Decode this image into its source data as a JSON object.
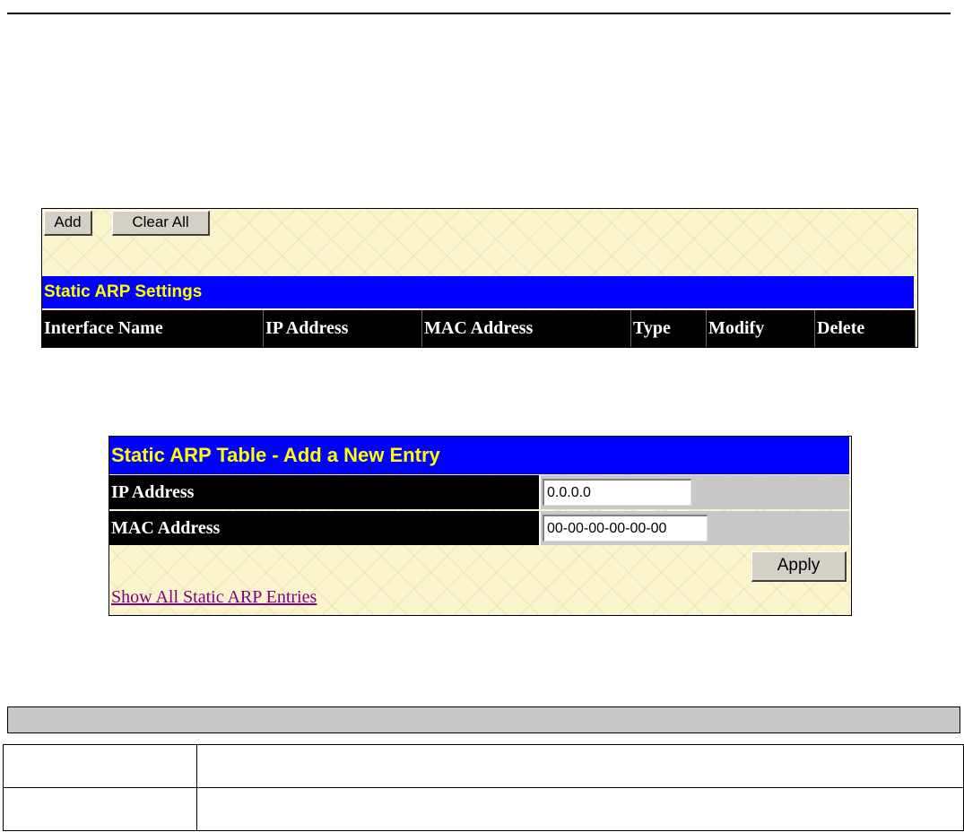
{
  "static_arp_settings": {
    "add_button": "Add",
    "clear_all_button": "Clear All",
    "title": "Static ARP Settings",
    "columns": [
      "Interface Name",
      "IP Address",
      "MAC Address",
      "Type",
      "Modify",
      "Delete"
    ]
  },
  "add_entry": {
    "title": "Static ARP Table - Add a New Entry",
    "ip_label": "IP Address",
    "ip_value": "0.0.0.0",
    "mac_label": "MAC Address",
    "mac_value": "00-00-00-00-00-00",
    "apply_button": "Apply",
    "show_all_link": "Show All Static ARP Entries"
  },
  "colors": {
    "panel_background": "#fbf5cd",
    "title_bar": "#0000ff",
    "title_text": "#ffff00",
    "header_background": "#000000",
    "link": "#800080"
  }
}
